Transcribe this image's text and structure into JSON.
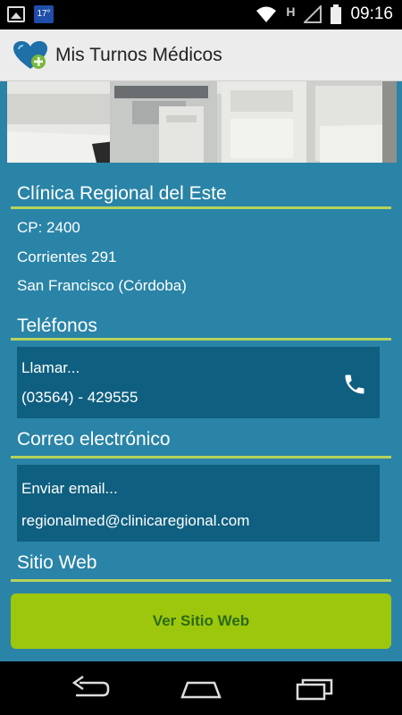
{
  "status_bar": {
    "calendar_day": "17°",
    "network_letter": "H",
    "time": "09:16",
    "icons": [
      "image-icon",
      "calendar-icon",
      "wifi-icon",
      "signal-icon",
      "battery-icon"
    ]
  },
  "action_bar": {
    "title": "Mis Turnos Médicos",
    "icon": "heart-plus-icon"
  },
  "clinic": {
    "name": "Clínica Regional del Este",
    "postal_code": "CP: 2400",
    "street": "Corrientes 291",
    "city": "San Francisco (Córdoba)"
  },
  "phones": {
    "title": "Teléfonos",
    "action": "Llamar...",
    "number": "(03564) - 429555",
    "icon": "phone-icon"
  },
  "email": {
    "title": "Correo electrónico",
    "action": "Enviar email...",
    "address": "regionalmed@clinicaregional.com"
  },
  "website": {
    "title": "Sitio Web",
    "button_label": "Ver Sitio Web"
  },
  "colors": {
    "background": "#2a84a7",
    "card": "#0f5f80",
    "accent_rule": "#b6d25a",
    "button": "#9dc70d",
    "button_text": "#2d6a14"
  },
  "nav_bar": {
    "icons": [
      "back-icon",
      "home-icon",
      "recent-apps-icon"
    ]
  }
}
